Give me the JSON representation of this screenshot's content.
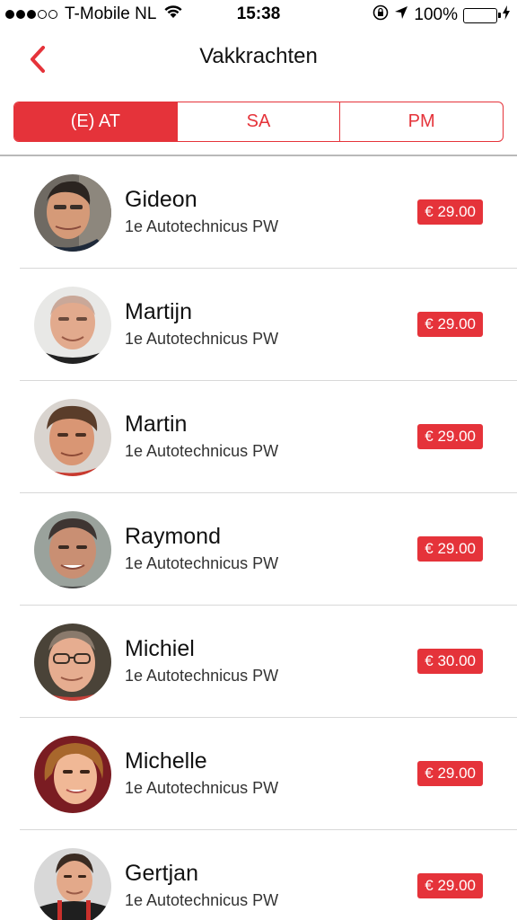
{
  "status_bar": {
    "carrier": "T-Mobile NL",
    "time": "15:38",
    "battery": "100%"
  },
  "nav": {
    "title": "Vakkrachten"
  },
  "tabs": [
    {
      "label": "(E) AT",
      "active": true
    },
    {
      "label": "SA",
      "active": false
    },
    {
      "label": "PM",
      "active": false
    }
  ],
  "colors": {
    "accent": "#e5333a"
  },
  "people": [
    {
      "name": "Gideon",
      "role": "1e Autotechnicus PW",
      "price": "€ 29.00",
      "avatar_icon": "person-photo"
    },
    {
      "name": "Martijn",
      "role": "1e Autotechnicus PW",
      "price": "€ 29.00",
      "avatar_icon": "person-photo"
    },
    {
      "name": "Martin",
      "role": "1e Autotechnicus PW",
      "price": "€ 29.00",
      "avatar_icon": "person-photo"
    },
    {
      "name": "Raymond",
      "role": "1e Autotechnicus PW",
      "price": "€ 29.00",
      "avatar_icon": "person-photo"
    },
    {
      "name": "Michiel",
      "role": "1e Autotechnicus PW",
      "price": "€ 30.00",
      "avatar_icon": "person-photo"
    },
    {
      "name": "Michelle",
      "role": "1e Autotechnicus PW",
      "price": "€ 29.00",
      "avatar_icon": "person-photo"
    },
    {
      "name": "Gertjan",
      "role": "1e Autotechnicus PW",
      "price": "€ 29.00",
      "avatar_icon": "person-photo"
    }
  ]
}
